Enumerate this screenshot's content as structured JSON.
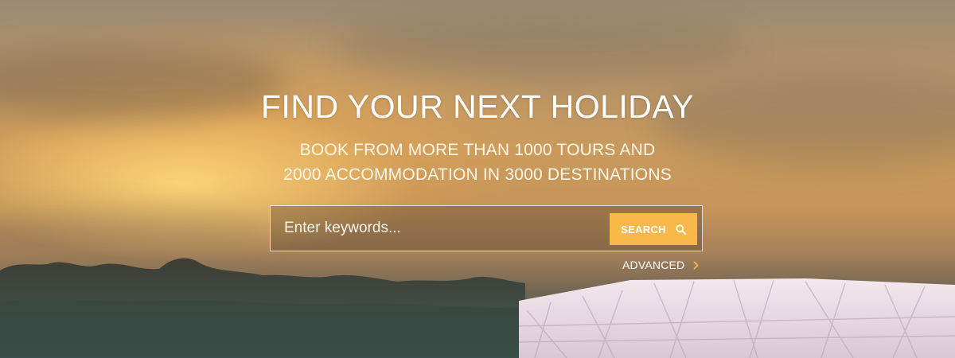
{
  "hero": {
    "title": "FIND YOUR NEXT HOLIDAY",
    "subtitle_line1": "BOOK FROM MORE THAN 1000 TOURS AND",
    "subtitle_line2": "2000 ACCOMMODATION IN 3000 DESTINATIONS"
  },
  "search": {
    "placeholder": "Enter keywords...",
    "value": "",
    "button_label": "SEARCH",
    "button_icon": "search-icon",
    "advanced_label": "ADVANCED",
    "advanced_icon": "chevron-right-icon"
  },
  "colors": {
    "accent": "#f9b84a",
    "text": "#ffffff"
  }
}
